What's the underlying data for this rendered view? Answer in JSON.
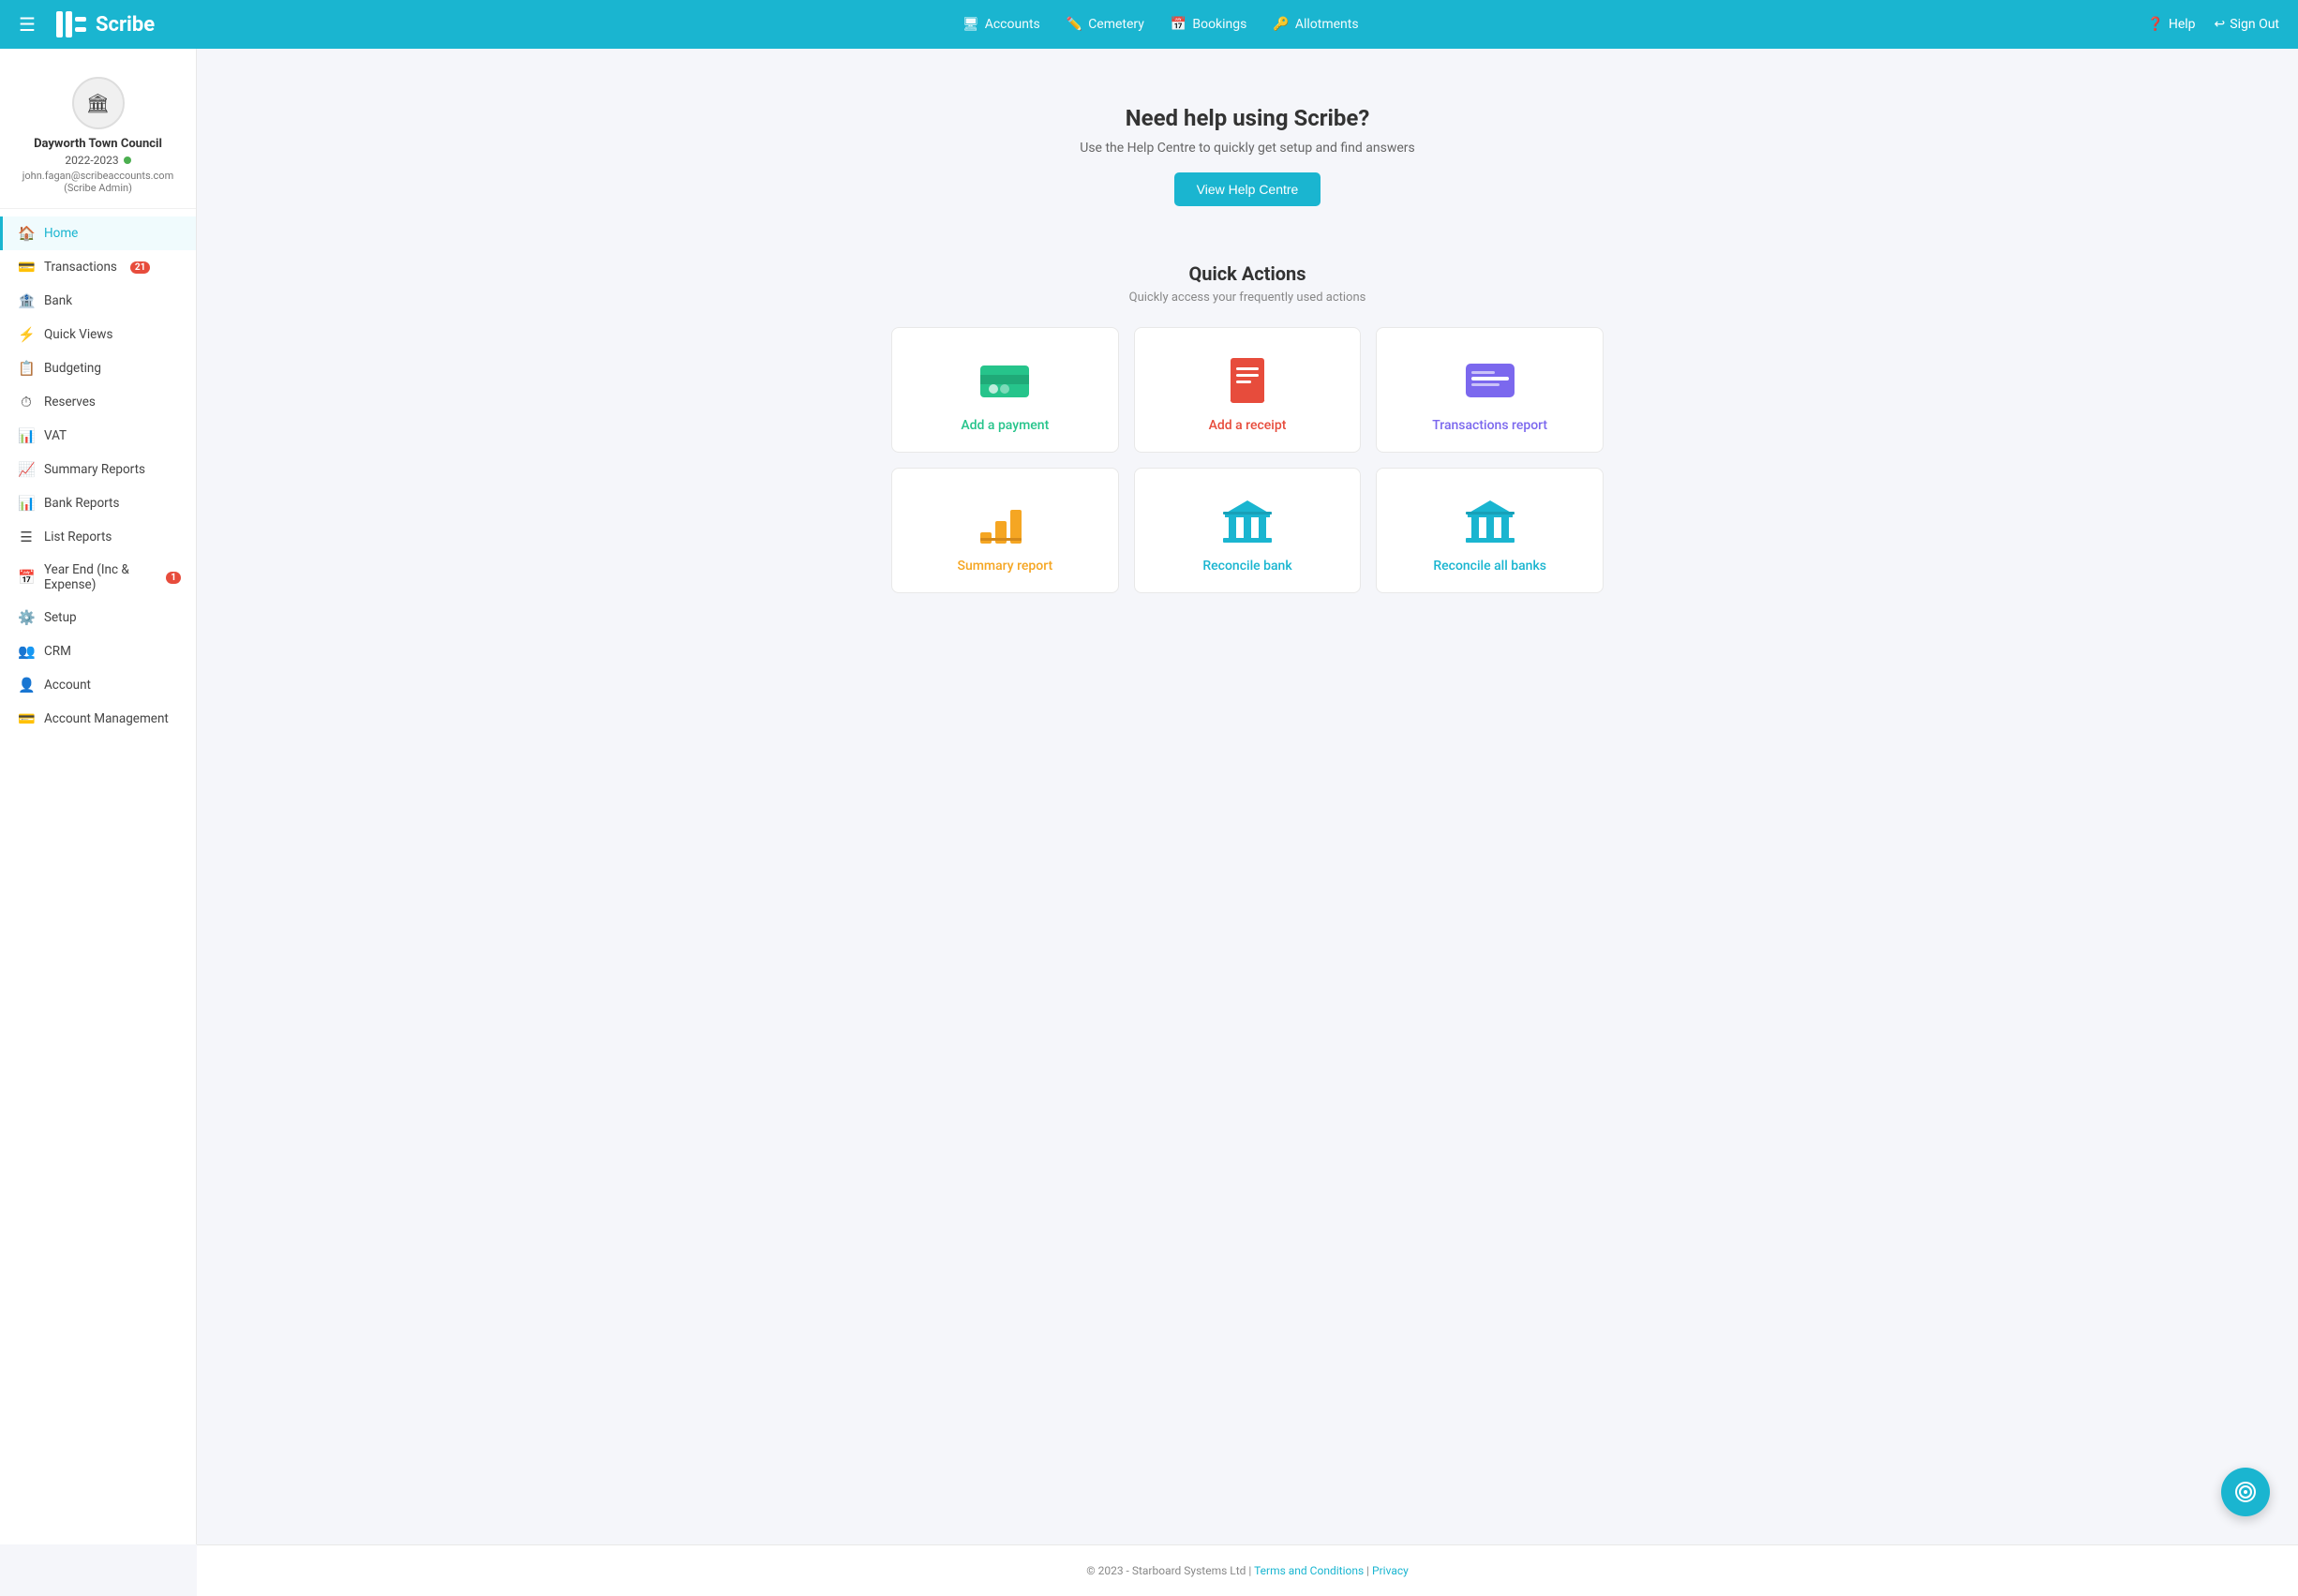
{
  "topnav": {
    "logo_text": "Scribe",
    "hamburger_label": "☰",
    "nav_links": [
      {
        "label": "Accounts",
        "icon": "🖥"
      },
      {
        "label": "Cemetery",
        "icon": "✏"
      },
      {
        "label": "Bookings",
        "icon": "📅"
      },
      {
        "label": "Allotments",
        "icon": "🔑"
      }
    ],
    "right_links": [
      {
        "label": "Help",
        "icon": "❓"
      },
      {
        "label": "Sign Out",
        "icon": "↩"
      }
    ]
  },
  "sidebar": {
    "profile": {
      "org_name": "Dayworth Town Council",
      "year": "2022-2023",
      "email": "john.fagan@scribeaccounts.com",
      "role": "(Scribe Admin)"
    },
    "items": [
      {
        "label": "Home",
        "icon": "🏠",
        "active": true
      },
      {
        "label": "Transactions",
        "icon": "💳",
        "badge": "21"
      },
      {
        "label": "Bank",
        "icon": "💳"
      },
      {
        "label": "Quick Views",
        "icon": "⚡"
      },
      {
        "label": "Budgeting",
        "icon": "💳"
      },
      {
        "label": "Reserves",
        "icon": "⏱"
      },
      {
        "label": "VAT",
        "icon": "📊"
      },
      {
        "label": "Summary Reports",
        "icon": "📈"
      },
      {
        "label": "Bank Reports",
        "icon": "📊"
      },
      {
        "label": "List Reports",
        "icon": "☰"
      },
      {
        "label": "Year End (Inc & Expense)",
        "icon": "📅",
        "badge": "1"
      },
      {
        "label": "Setup",
        "icon": "⚙"
      },
      {
        "label": "CRM",
        "icon": "👥"
      },
      {
        "label": "Account",
        "icon": "👤"
      },
      {
        "label": "Account Management",
        "icon": "💳"
      }
    ]
  },
  "help": {
    "title": "Need help using Scribe?",
    "subtitle": "Use the Help Centre to quickly get setup and find answers",
    "button_label": "View Help Centre"
  },
  "quick_actions": {
    "title": "Quick Actions",
    "subtitle": "Quickly access your frequently used actions",
    "cards": [
      {
        "label": "Add a payment",
        "color": "green",
        "type": "payment"
      },
      {
        "label": "Add a receipt",
        "color": "red",
        "type": "receipt"
      },
      {
        "label": "Transactions report",
        "color": "purple",
        "type": "transactions"
      },
      {
        "label": "Summary report",
        "color": "orange",
        "type": "summary"
      },
      {
        "label": "Reconcile bank",
        "color": "blue",
        "type": "bank"
      },
      {
        "label": "Reconcile all banks",
        "color": "blue2",
        "type": "allbanks"
      }
    ]
  },
  "footer": {
    "copyright": "© 2023 - Starboard Systems Ltd | ",
    "terms": "Terms and Conditions",
    "separator": " | ",
    "privacy": "Privacy"
  },
  "fab": {
    "icon": "⊕"
  }
}
